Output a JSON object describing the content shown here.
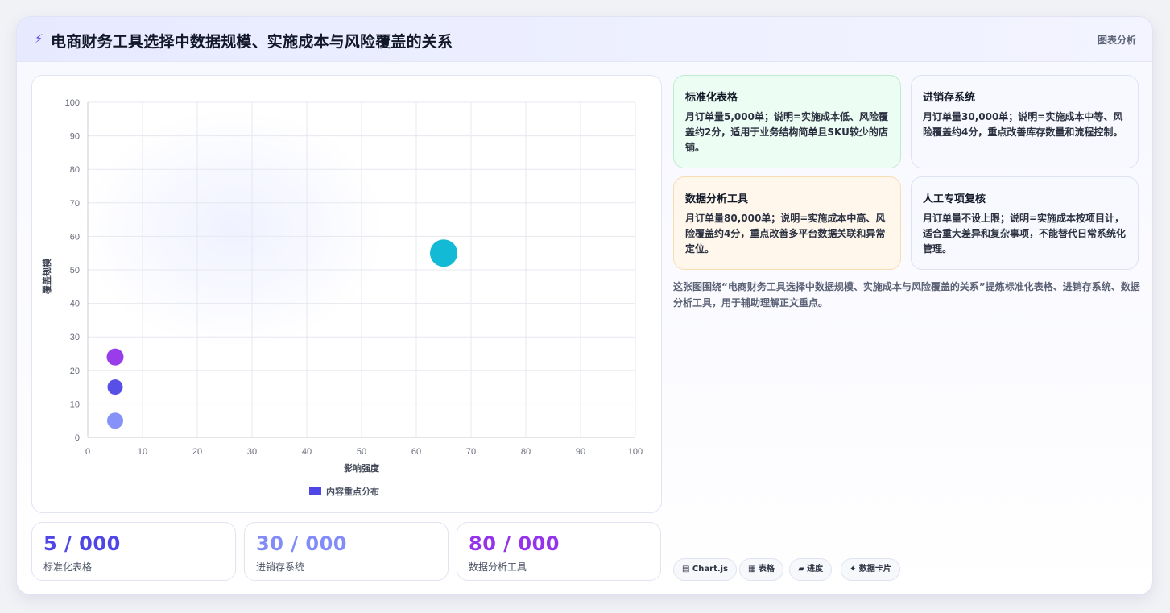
{
  "header": {
    "icon": "bolt-icon",
    "title": "电商财务工具选择中数据规模、实施成本与风险覆盖的关系",
    "tag": "图表分析"
  },
  "chart_data": {
    "type": "scatter",
    "xlabel": "影响强度",
    "ylabel": "覆盖规模",
    "xlim": [
      0,
      100
    ],
    "ylim": [
      0,
      100
    ],
    "x_ticks": [
      "0",
      "10",
      "20",
      "30",
      "40",
      "50",
      "60",
      "70",
      "80",
      "90",
      "100"
    ],
    "y_ticks": [
      "0",
      "10",
      "20",
      "30",
      "40",
      "50",
      "60",
      "70",
      "80",
      "90",
      "100"
    ],
    "grid": true,
    "legend": {
      "placement": "bottom",
      "label": "内容重点分布",
      "color": "#4f46e5"
    },
    "points": [
      {
        "x": 5,
        "y": 5,
        "r": 10,
        "color": "#818cf8"
      },
      {
        "x": 5,
        "y": 15,
        "r": 9.5,
        "color": "#4f46e5"
      },
      {
        "x": 5,
        "y": 24,
        "r": 10.5,
        "color": "#9333ea"
      },
      {
        "x": 65,
        "y": 55,
        "r": 17,
        "color": "#06b6d4"
      }
    ]
  },
  "stats": [
    {
      "value": "5 / 000",
      "label": "标准化表格",
      "color": "#4f46e5"
    },
    {
      "value": "30 / 000",
      "label": "进销存系统",
      "color": "#818cf8"
    },
    {
      "value": "80 / 000",
      "label": "数据分析工具",
      "color": "#9333ea"
    }
  ],
  "cards": [
    {
      "title": "标准化表格",
      "body": "月订单量5,000单；说明=实施成本低、风险覆盖约2分，适用于业务结构简单且SKU较少的店铺。"
    },
    {
      "title": "进销存系统",
      "body": "月订单量30,000单；说明=实施成本中等、风险覆盖约4分，重点改善库存数量和流程控制。"
    },
    {
      "title": "数据分析工具",
      "body": "月订单量80,000单；说明=实施成本中高、风险覆盖约4分，重点改善多平台数据关联和异常定位。"
    },
    {
      "title": "人工专项复核",
      "body": "月订单量不设上限；说明=实施成本按项目计，适合重大差异和复杂事项，不能替代日常系统化管理。"
    }
  ],
  "summary": "这张图围绕“电商财务工具选择中数据规模、实施成本与风险覆盖的关系”提炼标准化表格、进销存系统、数据分析工具，用于辅助理解正文重点。",
  "chips": [
    {
      "label": "▤ Chart.js"
    },
    {
      "label": "▦ 表格"
    },
    {
      "label": "▰ 进度"
    },
    {
      "label": "✦ 数据卡片"
    }
  ]
}
